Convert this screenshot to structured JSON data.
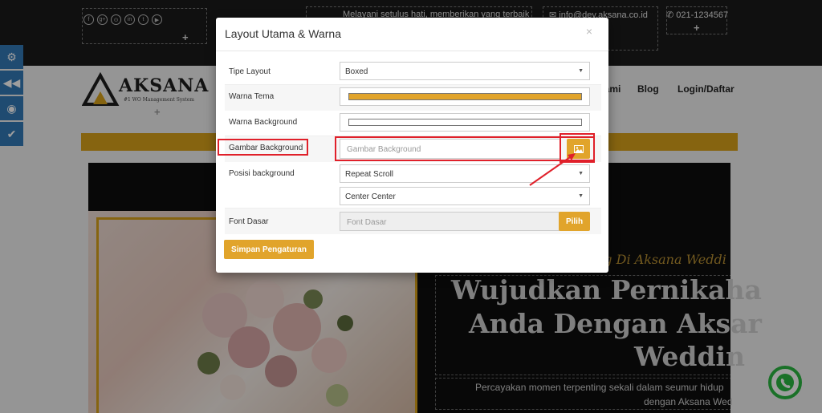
{
  "topbar": {
    "tagline": "Melayani setulus hati, memberikan yang terbaik",
    "email": "info@dev.aksana.co.id",
    "phone": "021-1234567",
    "plus": "+",
    "social_glyphs": [
      "f",
      "g+",
      "⊙",
      "in",
      "t",
      "▶"
    ]
  },
  "header": {
    "logo_name": "AKSANA",
    "logo_tagline": "#1 WO Management System",
    "nav": [
      "Kami",
      "Blog",
      "Login/Daftar"
    ]
  },
  "hero": {
    "script_line": "ng Di Aksana Weddi",
    "title_lines": [
      "Wujudkan Pernikaha",
      "Anda Dengan Aksar",
      "Weddin"
    ],
    "subtitle_lines": [
      "Percayakan momen terpenting sekali dalam seumur hidup",
      "dengan Aksana Wed"
    ]
  },
  "side_tools": [
    "gears-icon",
    "rewind-icon",
    "eye-icon",
    "check-icon"
  ],
  "modal": {
    "title": "Layout Utama & Warna",
    "close": "×",
    "tipe_layout": {
      "label": "Tipe Layout",
      "value": "Boxed"
    },
    "warna_tema": {
      "label": "Warna Tema",
      "color": "#e1a42b"
    },
    "warna_background": {
      "label": "Warna Background",
      "color": "#ffffff"
    },
    "gambar_background": {
      "label": "Gambar Background",
      "placeholder": "Gambar Background"
    },
    "posisi_background": {
      "label": "Posisi background",
      "repeat": "Repeat Scroll",
      "position": "Center Center"
    },
    "font_dasar": {
      "label": "Font Dasar",
      "placeholder": "Font Dasar",
      "button": "Pilih"
    },
    "save_button": "Simpan Pengaturan"
  },
  "colors": {
    "accent": "#e1a42b",
    "highlight": "#e0202a",
    "side_tool": "#337ab7"
  }
}
